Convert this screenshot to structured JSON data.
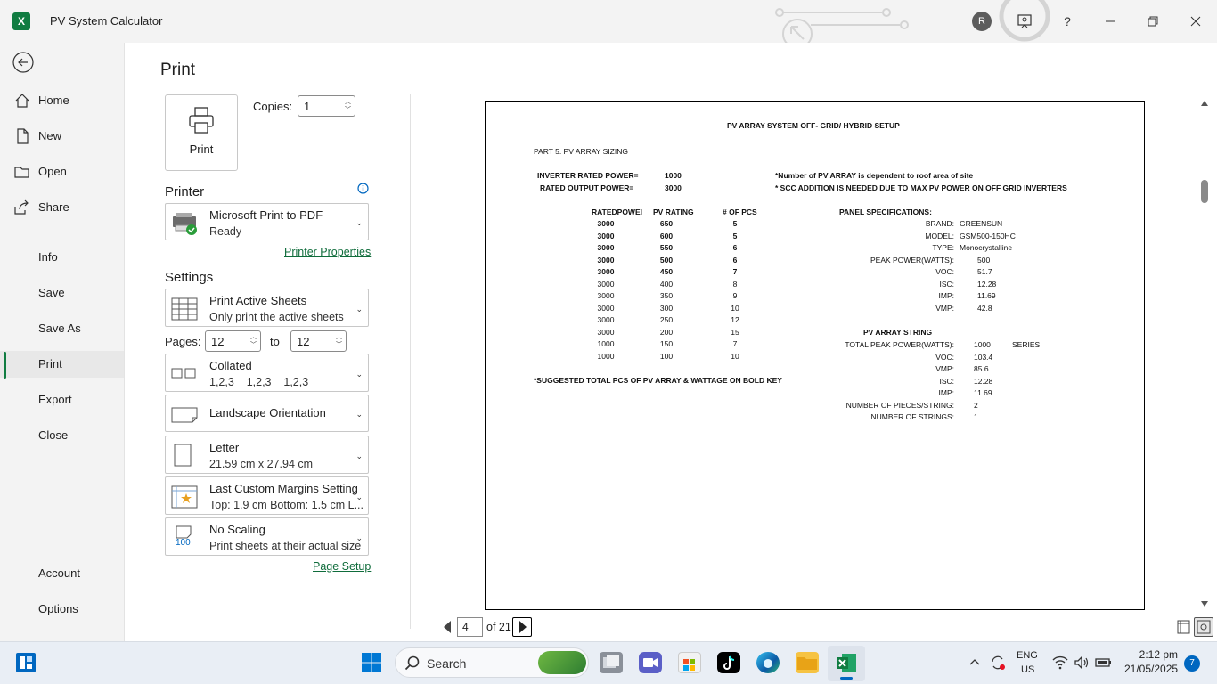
{
  "window": {
    "title": "PV System Calculator",
    "app_icon": "X",
    "avatar_initial": "R"
  },
  "nav": {
    "home": "Home",
    "new": "New",
    "open": "Open",
    "share": "Share",
    "info": "Info",
    "save": "Save",
    "save_as": "Save As",
    "print": "Print",
    "export": "Export",
    "close": "Close",
    "account": "Account",
    "options": "Options",
    "active": "Print"
  },
  "print": {
    "title": "Print",
    "button_label": "Print",
    "copies_label": "Copies:",
    "copies_value": "1"
  },
  "printer": {
    "heading": "Printer",
    "name": "Microsoft Print to PDF",
    "status": "Ready",
    "properties_link": "Printer Properties"
  },
  "settings": {
    "heading": "Settings",
    "what": {
      "title": "Print Active Sheets",
      "desc": "Only print the active sheets"
    },
    "pages_label": "Pages:",
    "pages_from": "12",
    "pages_to_label": "to",
    "pages_to": "12",
    "collation": {
      "title": "Collated",
      "desc": "1,2,3    1,2,3    1,2,3"
    },
    "orientation": {
      "title": "Landscape Orientation"
    },
    "paper": {
      "title": "Letter",
      "desc": "21.59 cm x 27.94 cm"
    },
    "margins": {
      "title": "Last Custom Margins Setting",
      "desc": "Top: 1.9 cm Bottom: 1.5 cm L..."
    },
    "scaling": {
      "title": "No Scaling",
      "desc": "Print sheets at their actual size",
      "icon_text": "100"
    },
    "page_setup_link": "Page Setup"
  },
  "preview": {
    "current_page": "4",
    "of_label": "of 21",
    "sheet": {
      "title": "PV ARRAY SYSTEM OFF- GRID/ HYBRID SETUP",
      "part": "PART 5. PV ARRAY SIZING",
      "inverter_rated_label": "INVERTER RATED POWER=",
      "inverter_rated_value": "1000",
      "rated_output_label": "RATED OUTPUT POWER=",
      "rated_output_value": "3000",
      "note1": "*Number of PV ARRAY is dependent to roof area of site",
      "note2": "* SCC ADDITION IS NEEDED DUE TO MAX PV POWER ON OFF GRID INVERTERS",
      "table_headers": [
        "RATEDPOWEI",
        "PV RATING",
        "# OF PCS"
      ],
      "table_rows": [
        [
          "3000",
          "650",
          "5"
        ],
        [
          "3000",
          "600",
          "5"
        ],
        [
          "3000",
          "550",
          "6"
        ],
        [
          "3000",
          "500",
          "6"
        ],
        [
          "3000",
          "450",
          "7"
        ],
        [
          "3000",
          "400",
          "8"
        ],
        [
          "3000",
          "350",
          "9"
        ],
        [
          "3000",
          "300",
          "10"
        ],
        [
          "3000",
          "250",
          "12"
        ],
        [
          "3000",
          "200",
          "15"
        ],
        [
          "1000",
          "150",
          "7"
        ],
        [
          "1000",
          "100",
          "10"
        ]
      ],
      "suggested_note": "*SUGGESTED TOTAL PCS OF PV ARRAY & WATTAGE ON BOLD KEY",
      "panel_heading": "PANEL SPECIFICATIONS:",
      "panel_specs": [
        [
          "BRAND:",
          "GREENSUN"
        ],
        [
          "MODEL:",
          "GSM500-150HC"
        ],
        [
          "TYPE:",
          "Monocrystalline"
        ],
        [
          "PEAK POWER(WATTS):",
          "500"
        ],
        [
          "VOC:",
          "51.7"
        ],
        [
          "ISC:",
          "12.28"
        ],
        [
          "IMP:",
          "11.69"
        ],
        [
          "VMP:",
          "42.8"
        ]
      ],
      "string_heading": "PV ARRAY STRING",
      "string_specs": [
        [
          "TOTAL PEAK POWER(WATTS):",
          "1000"
        ],
        [
          "VOC:",
          "103.4"
        ],
        [
          "VMP:",
          "85.6"
        ],
        [
          "ISC:",
          "12.28"
        ],
        [
          "IMP:",
          "11.69"
        ],
        [
          "NUMBER OF PIECES/STRING:",
          "2"
        ],
        [
          "NUMBER OF STRINGS:",
          "1"
        ]
      ],
      "series_label": "SERIES"
    }
  },
  "taskbar": {
    "search_label": "Search",
    "lang_line1": "ENG",
    "lang_line2": "US",
    "time": "2:12 pm",
    "date": "21/05/2025",
    "notification_count": "7"
  },
  "colors": {
    "accent": "#107c41",
    "link": "#0f6c3b",
    "taskbar": "#e9eef5"
  }
}
